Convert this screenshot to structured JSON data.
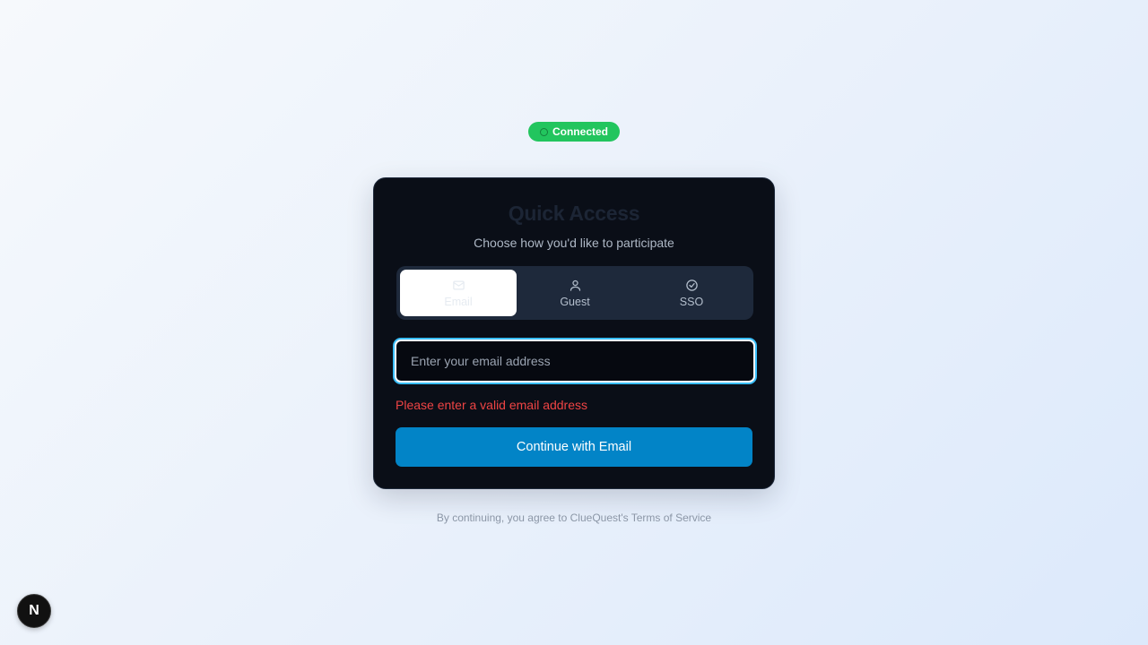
{
  "status": {
    "label": "Connected",
    "color": "#22c55e"
  },
  "card": {
    "title": "Quick Access",
    "subtitle": "Choose how you'd like to participate",
    "tabs": [
      {
        "label": "Email",
        "icon": "mail-icon",
        "active": true
      },
      {
        "label": "Guest",
        "icon": "user-icon",
        "active": false
      },
      {
        "label": "SSO",
        "icon": "check-circle-icon",
        "active": false
      }
    ],
    "email_input": {
      "value": "",
      "placeholder": "Enter your email address"
    },
    "error": "Please enter a valid email address",
    "submit_label": "Continue with Email"
  },
  "footer": {
    "terms": "By continuing, you agree to ClueQuest's Terms of Service"
  },
  "dev_badge": {
    "label": "N"
  },
  "colors": {
    "accent": "#0284c7",
    "error": "#ef4444",
    "card_bg": "#0a0e17",
    "focus_ring": "#38bdf8"
  }
}
